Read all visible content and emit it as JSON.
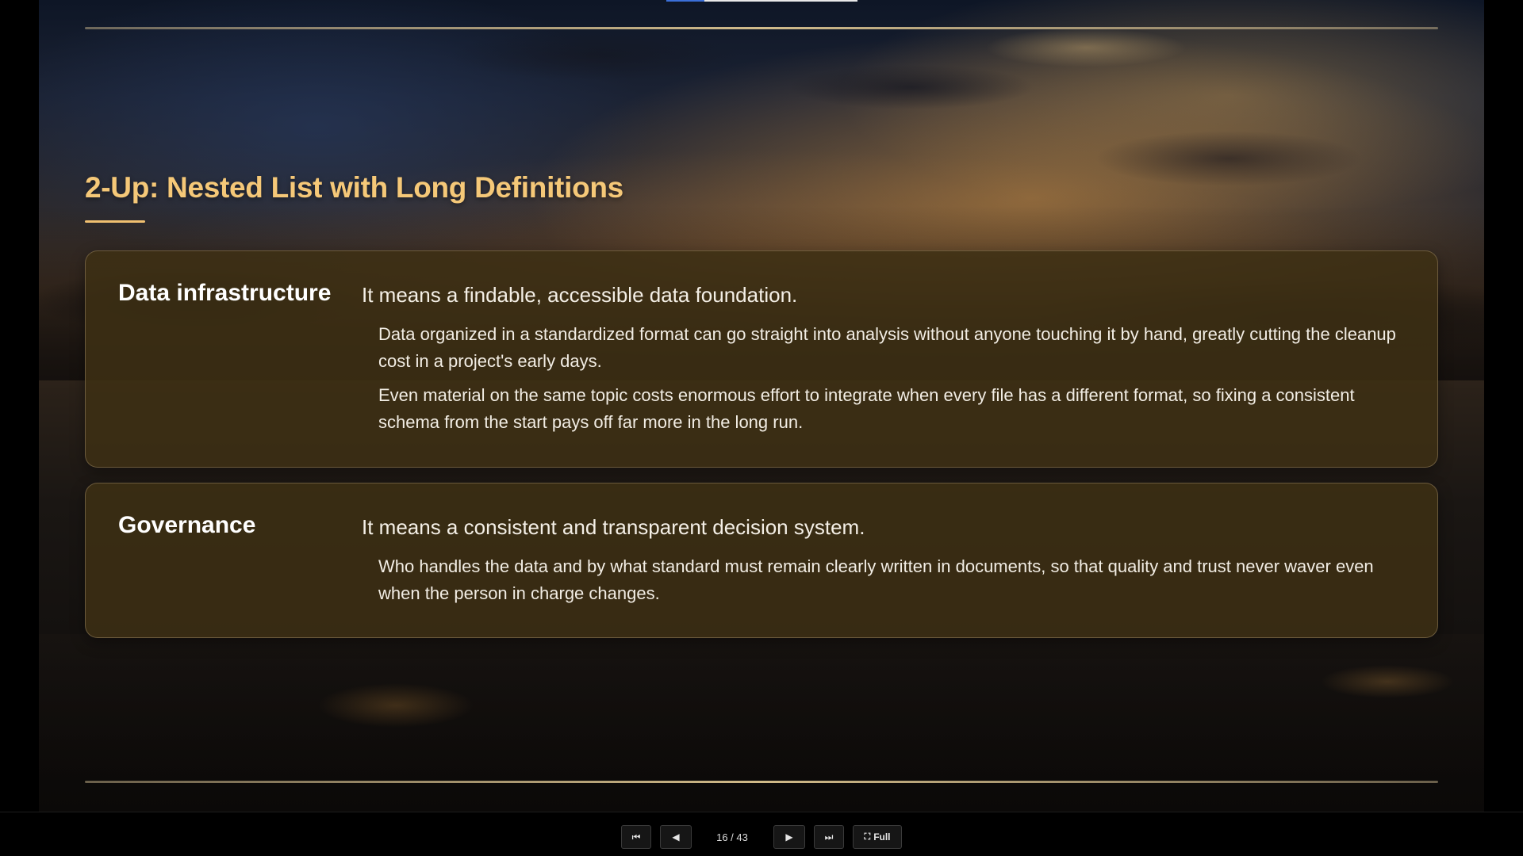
{
  "slide": {
    "title": "2-Up: Nested List with Long Definitions",
    "items": [
      {
        "term": "Data infrastructure",
        "definition": "It means a findable, accessible data foundation.",
        "details": [
          "Data organized in a standardized format can go straight into analysis without anyone touching it by hand, greatly cutting the cleanup cost in a project's early days.",
          "Even material on the same topic costs enormous effort to integrate when every file has a different format, so fixing a consistent schema from the start pays off far more in the long run."
        ]
      },
      {
        "term": "Governance",
        "definition": "It means a consistent and transparent decision system.",
        "details": [
          "Who handles the data and by what standard must remain clearly written in documents, so that quality and trust never waver even when the person in charge changes."
        ]
      }
    ]
  },
  "controls": {
    "first_icon": "⏮",
    "prev_icon": "◀",
    "counter": "16 / 43",
    "next_icon": "▶",
    "last_icon": "⏭",
    "full_icon": "⛶",
    "full_label": "Full"
  },
  "progress": {
    "fraction": 0.2
  },
  "colors": {
    "title": "#f5c878",
    "card_bg": "#3e3014",
    "accent": "#f0c070"
  }
}
